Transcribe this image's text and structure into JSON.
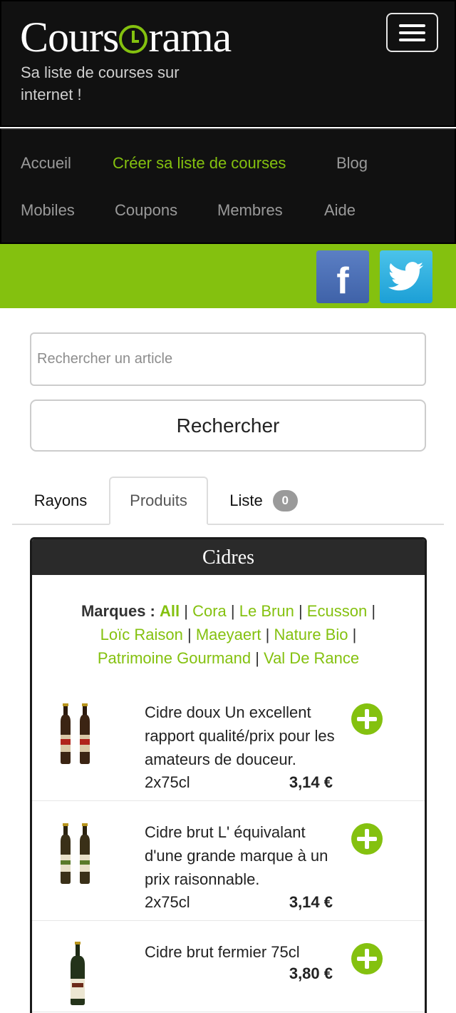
{
  "header": {
    "logo_part1": "Cours",
    "logo_part2": "rama",
    "tagline": "Sa liste de courses sur internet !"
  },
  "nav": {
    "items": [
      {
        "label": "Accueil",
        "active": false
      },
      {
        "label": "Créer sa liste de courses",
        "active": true
      },
      {
        "label": "Blog",
        "active": false
      },
      {
        "label": "Mobiles",
        "active": false
      },
      {
        "label": "Coupons",
        "active": false
      },
      {
        "label": "Membres",
        "active": false
      },
      {
        "label": "Aide",
        "active": false
      }
    ]
  },
  "social": {
    "facebook_letter": "f",
    "facebook_icon": "facebook-icon",
    "twitter_icon": "twitter-bird-icon"
  },
  "search": {
    "placeholder": "Rechercher un article",
    "value": "",
    "button_label": "Rechercher"
  },
  "tabs": [
    {
      "label": "Rayons",
      "active": false
    },
    {
      "label": "Produits",
      "active": true
    },
    {
      "label": "Liste",
      "active": false,
      "badge": "0"
    }
  ],
  "panel": {
    "title": "Cidres",
    "brands_label": "Marques :",
    "brands": [
      "All",
      "Cora",
      "Le Brun",
      "Ecusson",
      "Loïc Raison",
      "Maeyaert",
      "Nature Bio",
      "Patrimoine Gourmand",
      "Val De Rance"
    ],
    "products": [
      {
        "description": "Cidre doux Un excellent rapport qualité/prix pour les amateurs de douceur.",
        "size": "2x75cl",
        "price": "3,14 €",
        "image": "two-cider-bottles-red-label"
      },
      {
        "description": "Cidre brut L' équivalant d'une grande marque à un prix raisonnable.",
        "size": "2x75cl",
        "price": "3,14 €",
        "image": "two-cider-bottles-white-label"
      },
      {
        "description": "Cidre brut fermier 75cl",
        "size": "",
        "price": "3,80 €",
        "image": "single-cider-bottle"
      }
    ]
  },
  "colors": {
    "accent": "#84c10f",
    "header_bg": "#111111",
    "facebook": "#4a6db7",
    "twitter": "#2bb0e2"
  }
}
